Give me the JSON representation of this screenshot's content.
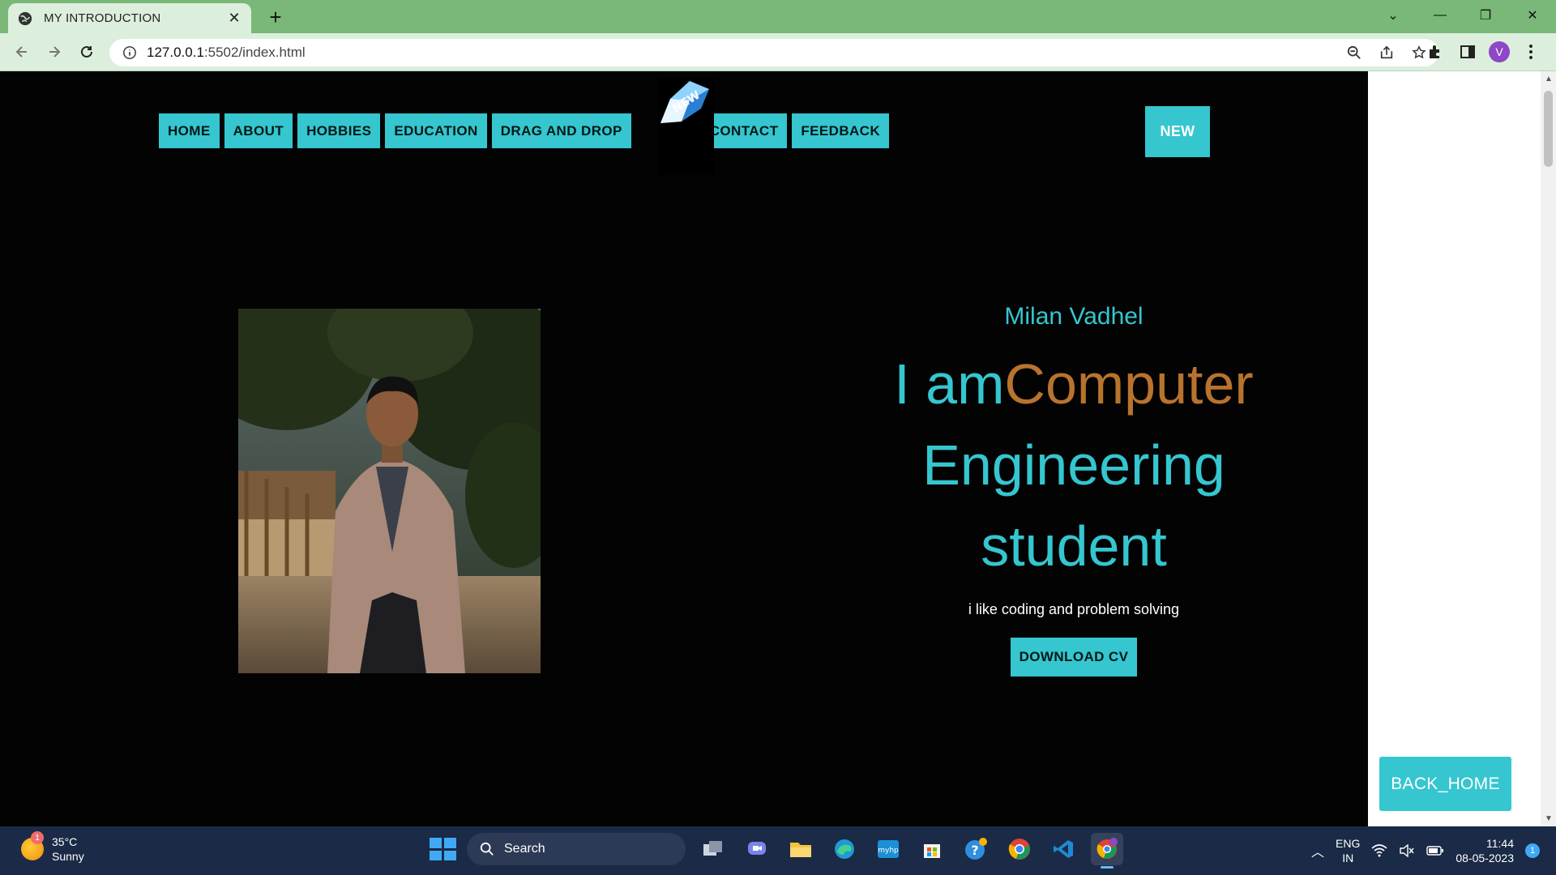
{
  "browser": {
    "tab_title": "MY INTRODUCTION",
    "url_host": "127.0.0.1",
    "url_rest": ":5502/index.html",
    "profile_initial": "V"
  },
  "nav": {
    "items": [
      "HOME",
      "ABOUT",
      "HOBBIES",
      "EDUCATION",
      "DRAG AND DROP",
      "CONTACT",
      "FEEDBACK"
    ],
    "new_button": "NEW",
    "new_badge_text": "NEW"
  },
  "hero": {
    "name": "Milan Vadhel",
    "title_prefix": "I am",
    "title_accent": "Computer",
    "title_rest": "Engineering student",
    "tagline": "i like coding and problem solving",
    "download_label": "DOWNLOAD CV"
  },
  "back_home_label": "BACK_HOME",
  "taskbar": {
    "weather_temp": "35°C",
    "weather_desc": "Sunny",
    "weather_badge": "1",
    "search_label": "Search",
    "lang_top": "ENG",
    "lang_bottom": "IN",
    "time": "11:44",
    "date": "08-05-2023",
    "notification_count": "1"
  },
  "colors": {
    "accent": "#35c6cf",
    "title_accent": "#b8732d",
    "page_bg": "#030303",
    "tabbar": "#79b879"
  }
}
